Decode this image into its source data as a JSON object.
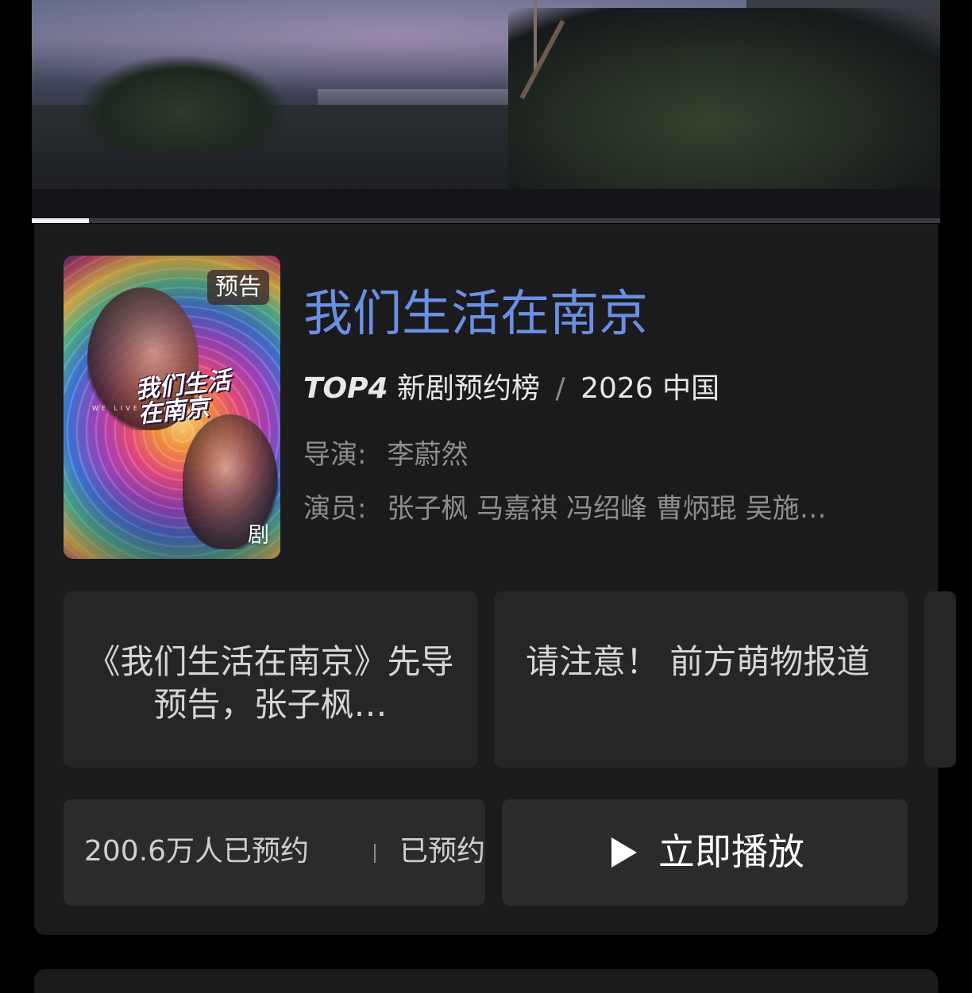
{
  "video": {
    "progress": 0.063
  },
  "show": {
    "poster_badge": "预告",
    "poster_type": "剧",
    "poster_logo": "我们生活在南京",
    "poster_logo_en": "WE LIVE IN NANJING",
    "title": "我们生活在南京",
    "rank": "TOP4",
    "rank_list": "新剧预约榜",
    "separator": "/",
    "year_region": "2026 中国",
    "director_label": "导演:",
    "director": "李蔚然",
    "cast_label": "演员:",
    "cast": "张子枫 马嘉祺 冯绍峰 曹炳琨 吴施…"
  },
  "related": [
    {
      "text": "《我们生活在南京》先导预告，张子枫…"
    },
    {
      "text": "请注意！ 前方萌物报道"
    }
  ],
  "actions": {
    "reservation_count": "200.6万人已预约",
    "reservation_state": "已预约",
    "play_label": "立即播放"
  },
  "colors": {
    "title": "#6b8fe3",
    "card_bg": "#1b1b1d",
    "button_bg": "#2b2b2d"
  },
  "icons": [
    "play-icon"
  ]
}
